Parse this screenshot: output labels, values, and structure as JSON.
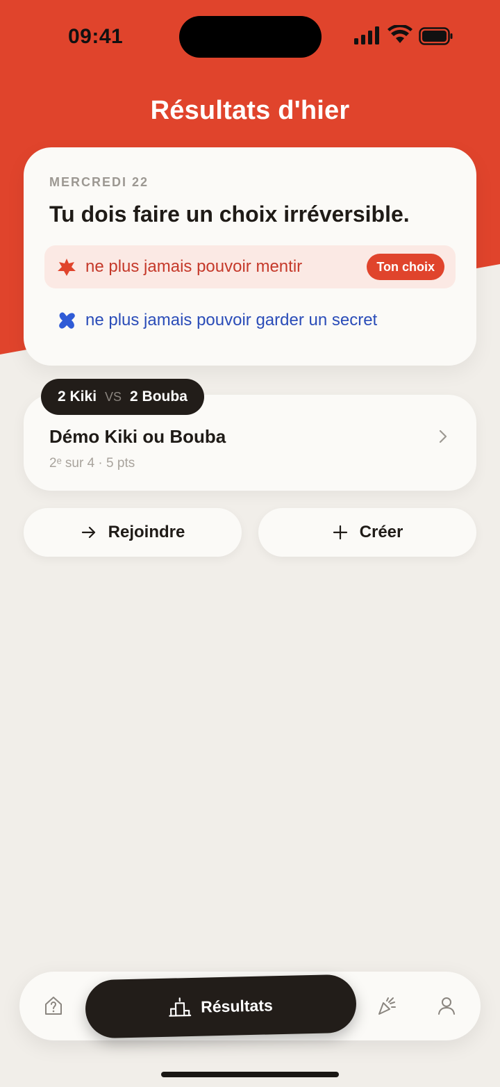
{
  "status_bar": {
    "time": "09:41"
  },
  "header": {
    "title": "Résultats d'hier"
  },
  "question": {
    "date": "MERCREDI 22",
    "text": "Tu dois faire un choix irréversible.",
    "options": [
      {
        "label": "ne plus jamais pouvoir mentir",
        "icon": "red-star-icon",
        "color": "#c5392a",
        "badge": "Ton choix"
      },
      {
        "label": "ne plus jamais pouvoir garder un secret",
        "icon": "blue-blob-icon",
        "color": "#2a4cb8"
      }
    ]
  },
  "group": {
    "score_left": "2 Kiki",
    "vs": "VS",
    "score_right": "2 Bouba",
    "name": "Démo Kiki ou Bouba",
    "rank": "2ᵉ sur 4 · 5 pts"
  },
  "actions": {
    "join": "Rejoindre",
    "create": "Créer"
  },
  "tab_bar": {
    "items": [
      {
        "name": "question",
        "icon": "question-house-icon"
      },
      {
        "name": "results",
        "icon": "podium-icon",
        "label": "Résultats",
        "active": true
      },
      {
        "name": "celebrate",
        "icon": "party-popper-icon"
      },
      {
        "name": "profile",
        "icon": "person-icon"
      }
    ]
  },
  "colors": {
    "accent": "#e0442c",
    "background": "#f1eee9",
    "card": "#fbfaf7",
    "dark": "#221d19"
  }
}
